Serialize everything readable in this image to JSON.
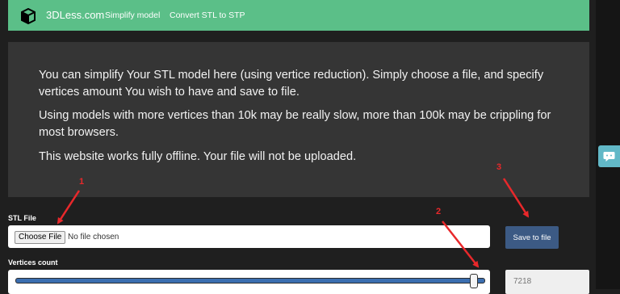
{
  "nav": {
    "brand": "3DLess.com",
    "links": [
      "Simplify model",
      "Convert STL to STP"
    ],
    "icon": "cube-icon"
  },
  "info": {
    "paragraphs": [
      "You can simplify Your STL model here (using vertice reduction). Simply choose a file, and specify vertices amount You wish to have and save to file.",
      "Using models with more vertices than 10k may be really slow, more than 100k may be crippling for most browsers.",
      "This website works fully offline. Your file will not be uploaded."
    ]
  },
  "form": {
    "stl_label": "STL File",
    "choose_label": "Choose File",
    "no_file_text": "No file chosen",
    "save_label": "Save to file",
    "vertices_label": "Vertices count",
    "vertices_value": "7218",
    "slider_level": 0.98
  },
  "annotations": [
    "1",
    "2",
    "3"
  ],
  "colors": {
    "navbar": "#5bbf88",
    "panel": "#353535",
    "save_button": "#3c5a84",
    "annotation": "#e8282b",
    "chat_widget": "#62b8c7"
  },
  "chat": {
    "icon": "chat-icon"
  }
}
